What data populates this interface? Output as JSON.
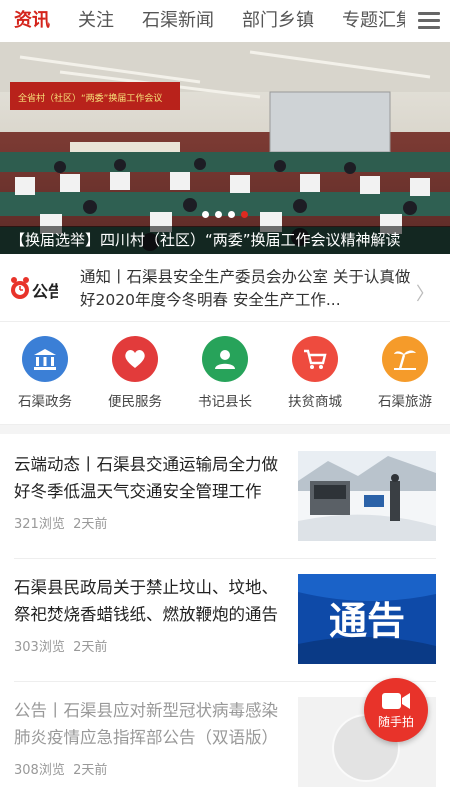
{
  "tabs": [
    "资讯",
    "关注",
    "石渠新闻",
    "部门乡镇",
    "专题汇集"
  ],
  "banner": {
    "caption": "【换届选举】四川村（社区）“两委”换届工作会议精神解读",
    "backdrop_text": "全省村（社区）“两委”换届工作会议",
    "active_dot": 3
  },
  "notice": {
    "icon_label": "公告",
    "text": "通知丨石渠县安全生产委员会办公室 关于认真做好2020年度今冬明春 安全生产工作..."
  },
  "services": [
    {
      "label": "石渠政务",
      "icon": "government-building-icon",
      "color": "#3b7fd6"
    },
    {
      "label": "便民服务",
      "icon": "heart-icon",
      "color": "#e23b3b"
    },
    {
      "label": "书记县长",
      "icon": "person-icon",
      "color": "#27a35a"
    },
    {
      "label": "扶贫商城",
      "icon": "shopping-cart-icon",
      "color": "#ee4b3e"
    },
    {
      "label": "石渠旅游",
      "icon": "palm-tree-icon",
      "color": "#f59b2a"
    }
  ],
  "news": [
    {
      "title": "云端动态丨石渠县交通运输局全力做好冬季低温天气交通安全管理工作",
      "views": "321浏览",
      "time": "2天前",
      "thumb": "snow-road"
    },
    {
      "title": "石渠县民政局关于禁止坟山、坟地、祭祀焚烧香蜡钱纸、燃放鞭炮的通告",
      "views": "303浏览",
      "time": "2天前",
      "thumb": "notice-banner",
      "thumb_text": "通告"
    },
    {
      "title": "公告丨石渠县应对新型冠状病毒感染肺炎疫情应急指挥部公告（双语版）",
      "views": "308浏览",
      "time": "2天前",
      "thumb": "blank"
    }
  ],
  "fab": {
    "label": "随手拍"
  }
}
